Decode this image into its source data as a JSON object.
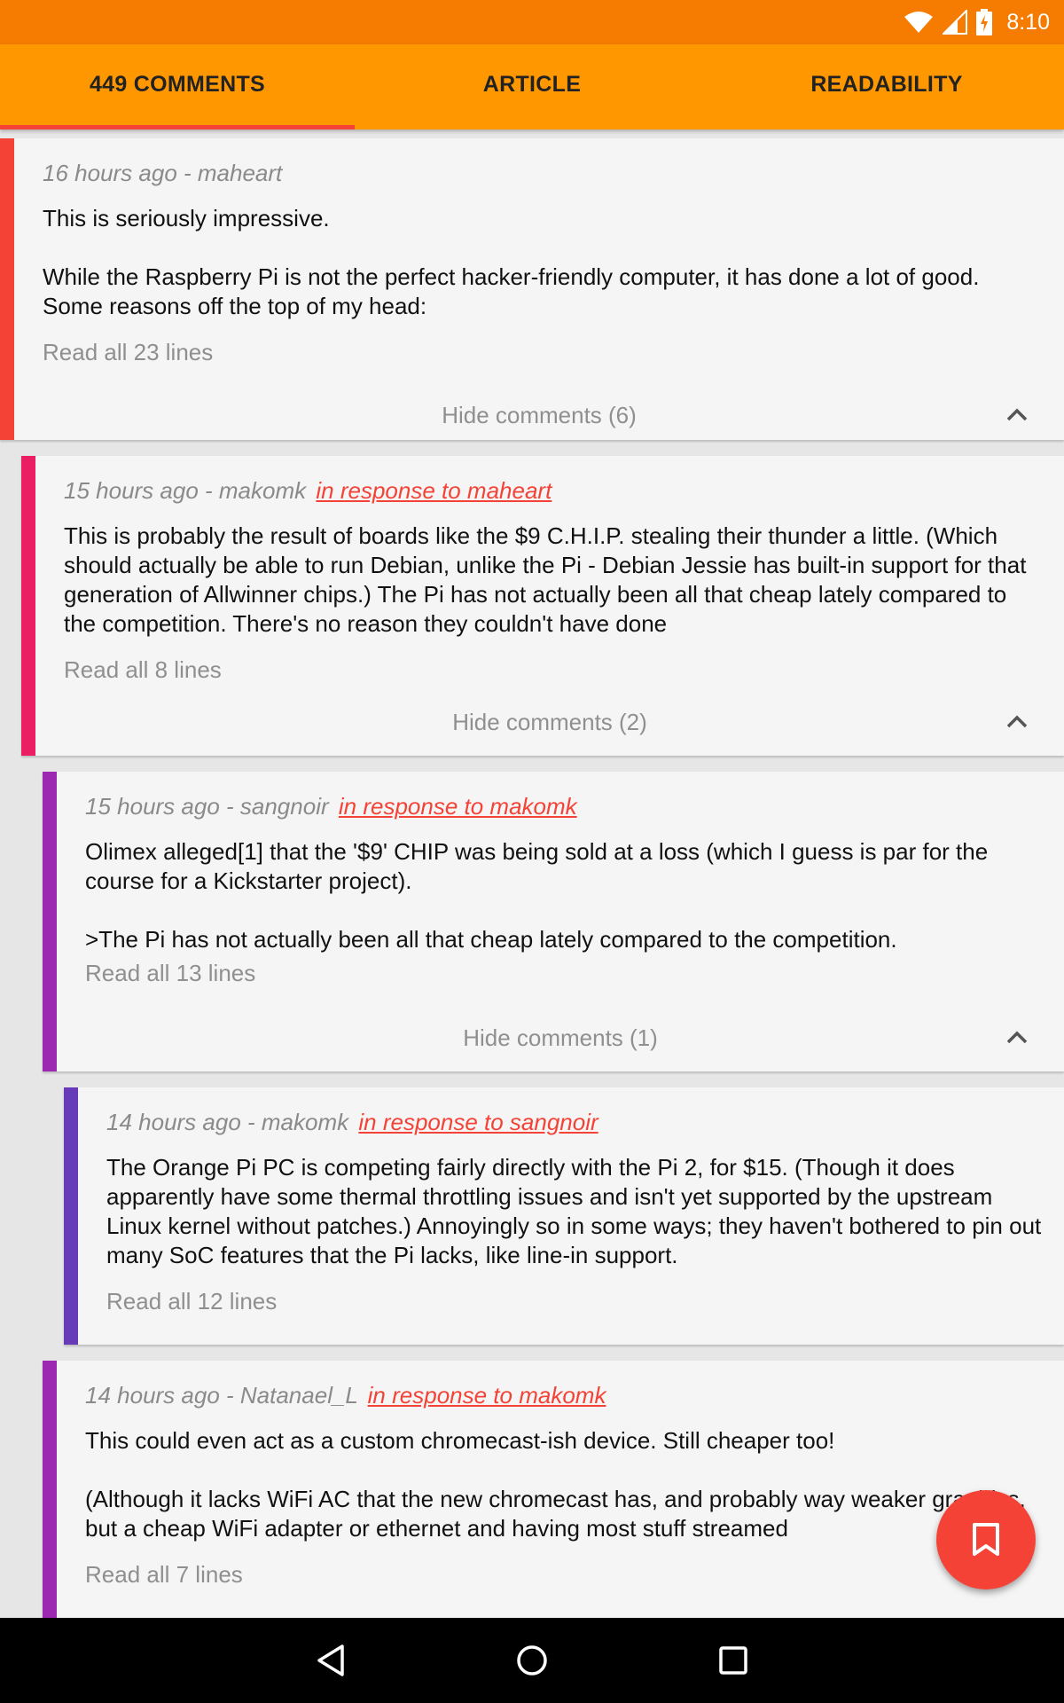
{
  "status_bar": {
    "time": "8:10"
  },
  "tabs": [
    {
      "label": "449 COMMENTS",
      "active": true
    },
    {
      "label": "ARTICLE",
      "active": false
    },
    {
      "label": "READABILITY",
      "active": false
    }
  ],
  "comments": [
    {
      "meta": "16 hours ago - maheart",
      "reply_to": "",
      "paragraphs": [
        "This is seriously impressive.",
        "While the Raspberry Pi is not the perfect hacker-friendly computer, it has done a lot of good. Some reasons off the top of my head:"
      ],
      "read_all": "Read all 23 lines",
      "hide_label": "Hide comments (6)",
      "bar_color": "#f44336"
    },
    {
      "meta": "15 hours ago - makomk",
      "reply_to": "in response to maheart",
      "paragraphs": [
        "This is probably the result of boards like the $9 C.H.I.P. stealing their thunder a little. (Which should actually be able to run Debian, unlike the Pi - Debian Jessie has built-in support for that generation of Allwinner chips.) The Pi has not actually been all that cheap lately compared to the competition. There's no reason they couldn't have done"
      ],
      "read_all": "Read all 8 lines",
      "hide_label": "Hide comments (2)",
      "bar_color": "#e91e63"
    },
    {
      "meta": "15 hours ago - sangnoir",
      "reply_to": "in response to makomk",
      "paragraphs": [
        "Olimex alleged[1] that the '$9' CHIP was being sold at a loss (which I guess is par for the course for a Kickstarter project).",
        ">The Pi has not actually been all that cheap lately compared to the competition."
      ],
      "read_all": "Read all 13 lines",
      "hide_label": "Hide comments (1)",
      "bar_color": "#9c27b0"
    },
    {
      "meta": "14 hours ago - makomk",
      "reply_to": "in response to sangnoir",
      "paragraphs": [
        "The Orange Pi PC is competing fairly directly with the Pi 2, for $15. (Though it does apparently have some thermal throttling issues and isn't yet supported by the upstream Linux kernel without patches.) Annoyingly so in some ways; they haven't bothered to pin out many SoC features that the Pi lacks, like line-in support."
      ],
      "read_all": "Read all 12 lines",
      "hide_label": "",
      "bar_color": "#673ab7"
    },
    {
      "meta": "14 hours ago - Natanael_L",
      "reply_to": "in response to makomk",
      "paragraphs": [
        "This could even act as a custom chromecast-ish device. Still cheaper too!",
        "(Although it lacks WiFi AC that the new chromecast has, and probably way weaker graphics, but a cheap WiFi adapter or ethernet and having most stuff streamed"
      ],
      "read_all": "Read all 7 lines",
      "hide_label": "",
      "bar_color": "#9c27b0"
    }
  ],
  "icons": {
    "wifi": "wifi-icon",
    "signal": "signal-icon",
    "battery": "battery-charging-icon",
    "chevron": "chevron-up-icon",
    "fab": "bookmark-icon",
    "back": "back-icon",
    "home": "home-icon",
    "recents": "recents-icon"
  },
  "colors": {
    "status_bar": "#f57c00",
    "toolbar": "#ff9800",
    "accent": "#f44336"
  }
}
